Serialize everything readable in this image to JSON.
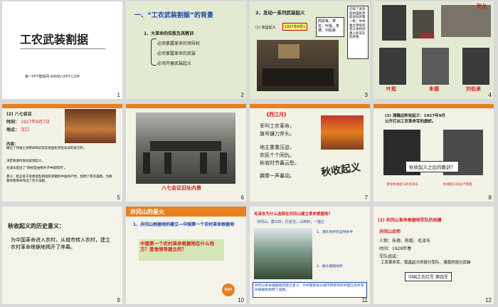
{
  "slides": [
    {
      "num": "1",
      "title": "工农武装割据",
      "footer": "第一PPT模板网-WWW.1PPT.COM"
    },
    {
      "num": "2",
      "heading": "一、“工农武装割据”的背景",
      "sub": "1、大革命的失败及其教训",
      "lessons": [
        "必须掌握革命的领导权",
        "必须掌握革命的武装",
        "必须开展武装起义"
      ]
    },
    {
      "num": "3",
      "heading": "2、发动一系列武装起义",
      "item": "(1) 南昌起义",
      "date": "1927年8月1",
      "leaders": "周恩来、贺龙、叶挺、朱德、刘伯承",
      "note": "打响了武装反抗国民党反动派的第一枪；中共独立领导武装斗争和创建人民军队的开始"
    },
    {
      "num": "4",
      "names": [
        "贺龙",
        "周恩来",
        "叶挺",
        "朱德",
        "刘伯承"
      ]
    },
    {
      "num": "5",
      "heading": "(2) 八七会议",
      "time_label": "时间：",
      "time": "1927年8月7日",
      "place_label": "地点：",
      "place": "汉口",
      "content_label": "内容：",
      "c1": "确立了开展土地革命和武装反抗国民党反动派的总方针。",
      "c2": "决定秋收时发动武装起义。",
      "c3": "毛泽东提出了“政权是由枪杆子中取得的”。",
      "c4": "意义：给正处于思想混乱和组织涣散的中国共产党，指明了新的道路，为挽救党和革命作出了巨大贡献。"
    },
    {
      "num": "6",
      "caption": "八七会议旧址内景"
    },
    {
      "num": "7",
      "poem_title": "《西江月》",
      "lines": [
        "军叫工农革命，",
        "旗号镰刀斧头。",
        "地主重重压迫，",
        "农民个个同仇。",
        "秋收时节暮云愁，",
        "霹雳一声暴动。"
      ],
      "calligraphy": "秋收起义"
    },
    {
      "num": "8",
      "heading": "(3) 湘赣边秋收起义：1927年9月",
      "heading2": "公开打出工农革命军的旗帜。",
      "question": "秋收起义之后的教训？",
      "name1": "领导秋收起义的毛泽东",
      "name2": "秋收起义旧址卢德铭"
    },
    {
      "num": "9",
      "title": "秋收起义的历史意义：",
      "body": "为中国革命进入农村，从城市转入农村，建立农村革命根据地揭开了序幕。"
    },
    {
      "num": "10",
      "banner": "井冈山的星火",
      "item": "1、井冈山根据地的建立—中国第一个农村革命根据地",
      "question": "中国第一个农村革命根据地在什么地方？是谁领导建立的？",
      "go": "GO!"
    },
    {
      "num": "11",
      "q": "毛泽东为什么选择在井冈山建立革命根据地？",
      "a": "井冈山：群众好；历史往；山林好；一独立",
      "p1": "1、湘东地界的自然条件",
      "p2": "2、群众基础地界",
      "b": "井冈山革命根据地的建立意义：为中国革命从城市转移到农村建立农村革命根据地指明了道路。"
    },
    {
      "num": "12",
      "heading": "(2) 井冈山革命根据地军队的创建",
      "sub": "井冈山会师",
      "people": "人物：朱德、陈毅、毛泽东",
      "time": "时间：1928年春",
      "army": "军队组成：",
      "army_text": "工农革命军、南昌起义的部分军队、湘南的部分武装",
      "unit": "中国工农红军  第四军"
    }
  ]
}
